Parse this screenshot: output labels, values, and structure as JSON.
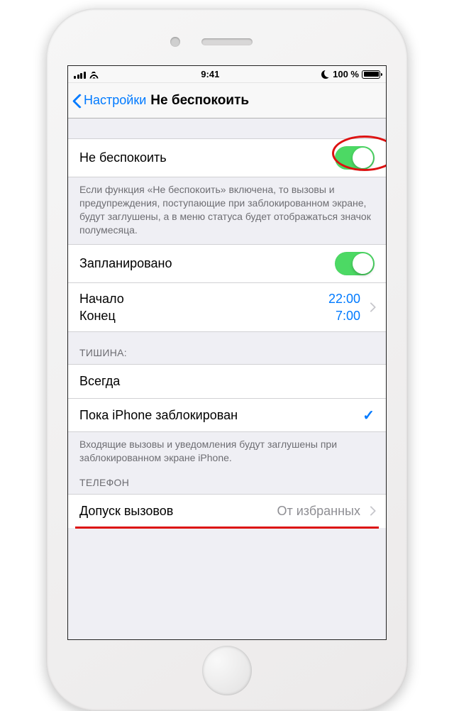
{
  "status": {
    "time": "9:41",
    "battery_text": "100 %"
  },
  "nav": {
    "back_label": "Настройки",
    "title": "Не беспокоить"
  },
  "dnd": {
    "label": "Не беспокоить",
    "footer": "Если функция «Не беспокоить» включена, то вызовы и предупреждения, поступающие при заблокированном экране, будут заглушены, а в меню статуса будет отображаться значок полумесяца."
  },
  "scheduled": {
    "label": "Запланировано",
    "from_label": "Начало",
    "from_value": "22:00",
    "to_label": "Конец",
    "to_value": "7:00"
  },
  "silence": {
    "header": "ТИШИНА:",
    "always": "Всегда",
    "while_locked": "Пока iPhone заблокирован",
    "footer": "Входящие вызовы и уведомления будут заглушены при заблокированном экране iPhone."
  },
  "phone": {
    "header": "ТЕЛЕФОН",
    "allow_calls_label": "Допуск вызовов",
    "allow_calls_value": "От избранных"
  }
}
